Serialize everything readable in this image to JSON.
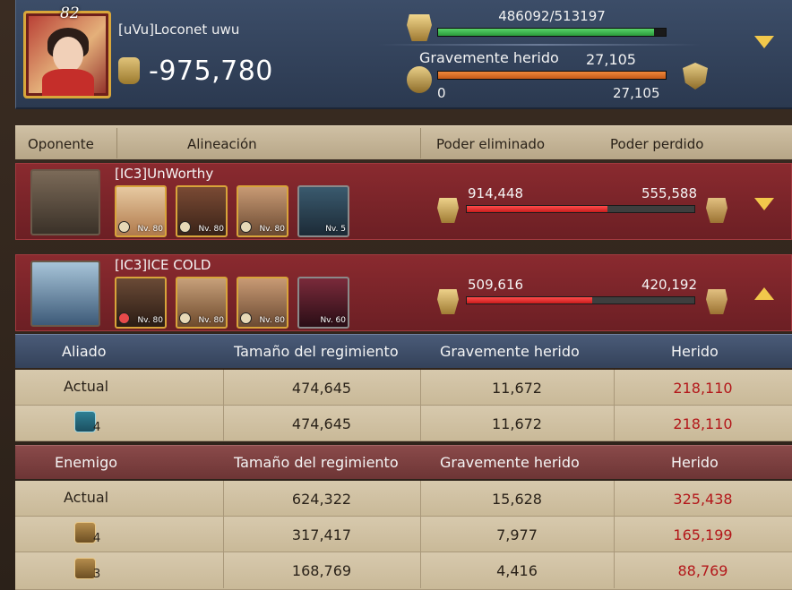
{
  "player": {
    "level": "82",
    "name": "[uVu]Loconet uwu",
    "power_change": "-975,780",
    "hp_text": "486092/513197",
    "hp_fraction": 0.947,
    "severe_label": "Gravemente herido",
    "severe_value": "27,105",
    "severe_min": "0",
    "severe_max": "27,105",
    "severe_fraction": 1.0
  },
  "columns": {
    "opponent": "Oponente",
    "lineup": "Alineación",
    "killed": "Poder eliminado",
    "lost": "Poder perdido"
  },
  "opponents": [
    {
      "name": "[IC3]UnWorthy",
      "killed": "914,448",
      "lost": "555,588",
      "killed_fraction": 0.62,
      "troops": [
        {
          "level": "Nv. 80",
          "icon": "horse-icon"
        },
        {
          "level": "Nv. 80",
          "icon": "sword-icon"
        },
        {
          "level": "Nv. 80",
          "icon": "sword-icon"
        },
        {
          "level": "Nv. 5",
          "icon": "dragon-icon"
        }
      ]
    },
    {
      "name": "[IC3]ICE COLD",
      "killed": "509,616",
      "lost": "420,192",
      "killed_fraction": 0.55,
      "troops": [
        {
          "level": "Nv. 80",
          "icon": "shield-icon"
        },
        {
          "level": "Nv. 80",
          "icon": "horse-icon"
        },
        {
          "level": "Nv. 80",
          "icon": "sword-icon"
        },
        {
          "level": "Nv. 60",
          "icon": "dragon-icon"
        }
      ]
    }
  ],
  "ally_table": {
    "header": [
      "Aliado",
      "Tamaño del regimiento",
      "Gravemente herido",
      "Herido"
    ],
    "rows": [
      {
        "label": "Actual",
        "size": "474,645",
        "severe": "11,672",
        "wounded": "218,110"
      },
      {
        "label_icon": "horse-icon",
        "tier": "4",
        "size": "474,645",
        "severe": "11,672",
        "wounded": "218,110"
      }
    ]
  },
  "enemy_table": {
    "header": [
      "Enemigo",
      "Tamaño del regimiento",
      "Gravemente herido",
      "Herido"
    ],
    "rows": [
      {
        "label": "Actual",
        "size": "624,322",
        "severe": "15,628",
        "wounded": "325,438"
      },
      {
        "label_icon": "sword-icon",
        "tier": "4",
        "size": "317,417",
        "severe": "7,977",
        "wounded": "165,199"
      },
      {
        "label_icon": "sword-icon",
        "tier": "3",
        "size": "168,769",
        "severe": "4,416",
        "wounded": "88,769"
      }
    ]
  },
  "colors": {
    "header_bg": "#34425a",
    "opponent_bg": "#7a2429",
    "hp_bar": "#3cbf4f",
    "severe_bar": "#e6742a",
    "killed_bar": "#e52a2a",
    "wounded_text": "#b3171a",
    "accent_arrow": "#f2c84b"
  }
}
